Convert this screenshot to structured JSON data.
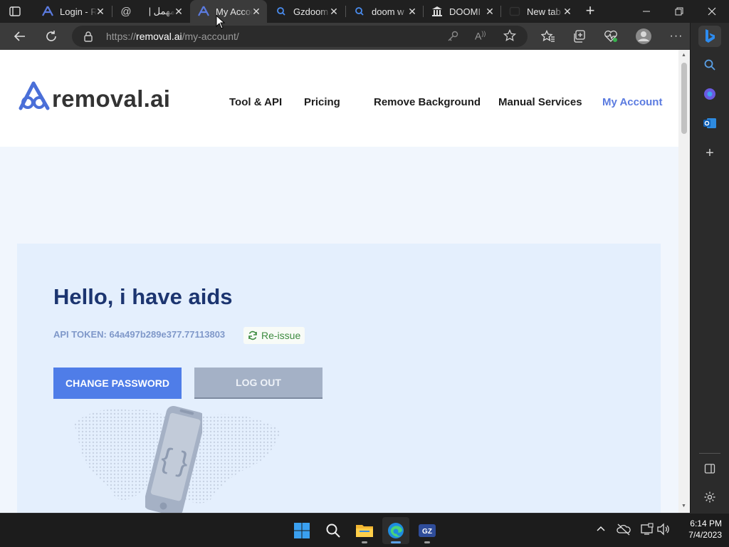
{
  "browser": {
    "tabs": [
      {
        "title": "Login - R",
        "icon": "removal-ai-logo-icon"
      },
      {
        "title": "مهمل | ‏‎‏",
        "icon": "at-sign-icon"
      },
      {
        "title": "My Account",
        "icon": "removal-ai-logo-icon",
        "active": true
      },
      {
        "title": "Gzdoom",
        "icon": "search-icon"
      },
      {
        "title": "doom w",
        "icon": "search-icon"
      },
      {
        "title": "DOOMI",
        "icon": "museum-icon"
      },
      {
        "title": "New tab",
        "icon": "new-tab-icon"
      }
    ],
    "url_prefix": "https://",
    "url_domain": "removal.ai",
    "url_path": "/my-account/"
  },
  "site": {
    "logo_text": "removal.ai",
    "nav": [
      "Tool & API",
      "Pricing",
      "Remove Background",
      "Manual Services",
      "My Account"
    ],
    "active_nav": "My Account"
  },
  "account": {
    "greeting": "Hello, i have aids",
    "api_token_label": "API TOKEN: 64a497b289e377.77113803",
    "reissue_label": "Re-issue",
    "change_password_label": "CHANGE PASSWORD",
    "logout_label": "LOG OUT"
  },
  "taskbar": {
    "time": "6:14 PM",
    "date": "7/4/2023"
  },
  "colors": {
    "accent": "#4f7de8",
    "heading": "#1c3570",
    "nav_active": "#5b7be0"
  }
}
